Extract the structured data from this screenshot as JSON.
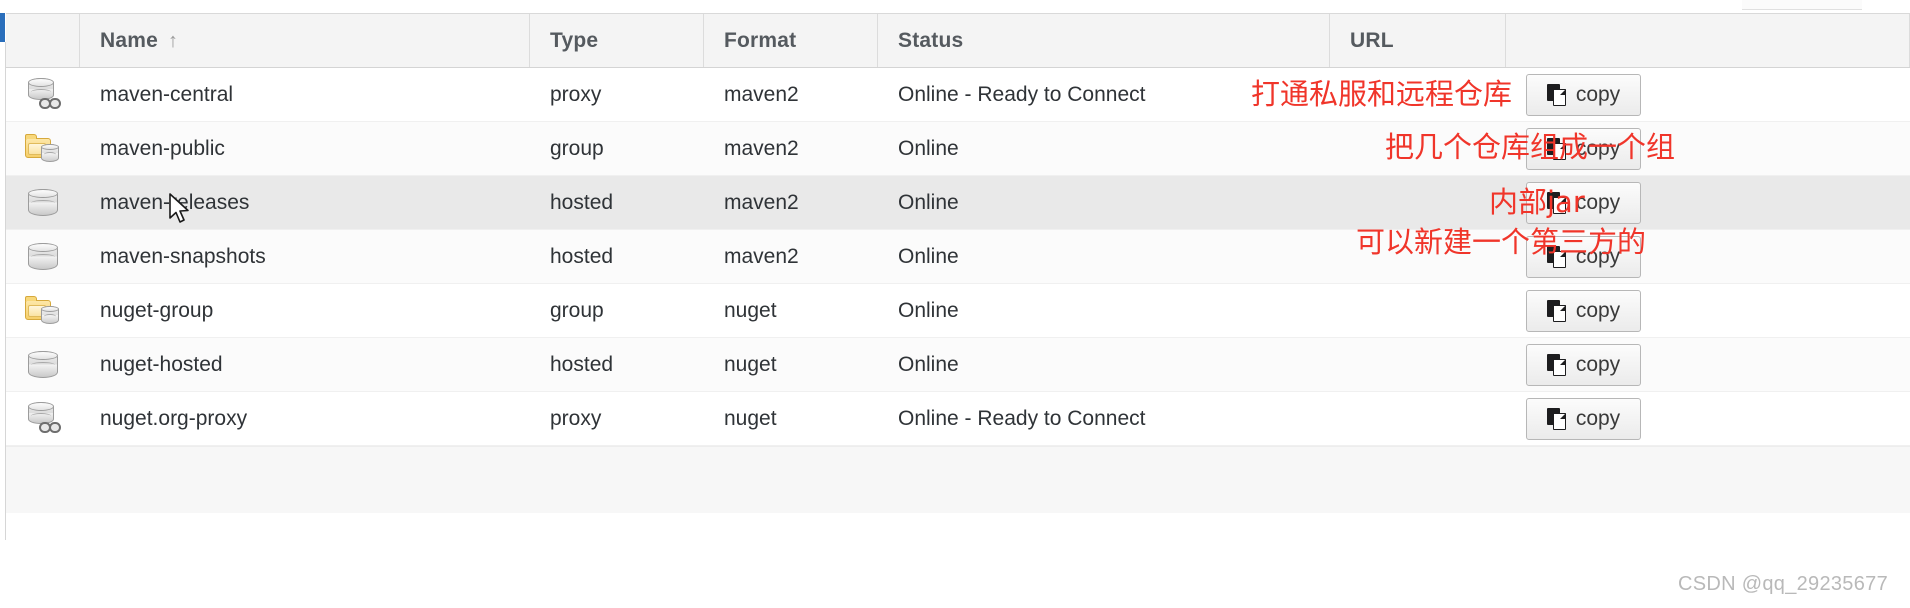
{
  "table": {
    "columns": [
      {
        "key": "icon",
        "label": ""
      },
      {
        "key": "name",
        "label": "Name",
        "sort": "↑"
      },
      {
        "key": "type",
        "label": "Type"
      },
      {
        "key": "format",
        "label": "Format"
      },
      {
        "key": "status",
        "label": "Status"
      },
      {
        "key": "url",
        "label": "URL"
      },
      {
        "key": "copy",
        "label": ""
      }
    ],
    "rows": [
      {
        "icon": "proxy-repository-icon",
        "name": "maven-central",
        "type": "proxy",
        "format": "maven2",
        "status": "Online - Ready to Connect",
        "copy_label": "copy"
      },
      {
        "icon": "group-repository-icon",
        "name": "maven-public",
        "type": "group",
        "format": "maven2",
        "status": "Online",
        "copy_label": "copy"
      },
      {
        "icon": "hosted-repository-icon",
        "name": "maven-releases",
        "type": "hosted",
        "format": "maven2",
        "status": "Online",
        "copy_label": "copy"
      },
      {
        "icon": "hosted-repository-icon",
        "name": "maven-snapshots",
        "type": "hosted",
        "format": "maven2",
        "status": "Online",
        "copy_label": "copy"
      },
      {
        "icon": "group-repository-icon",
        "name": "nuget-group",
        "type": "group",
        "format": "nuget",
        "status": "Online",
        "copy_label": "copy"
      },
      {
        "icon": "hosted-repository-icon",
        "name": "nuget-hosted",
        "type": "hosted",
        "format": "nuget",
        "status": "Online",
        "copy_label": "copy"
      },
      {
        "icon": "proxy-repository-icon",
        "name": "nuget.org-proxy",
        "type": "proxy",
        "format": "nuget",
        "status": "Online - Ready to Connect",
        "copy_label": "copy"
      }
    ]
  },
  "annotations": [
    {
      "id": "an1",
      "text": "打通私服和远程仓库"
    },
    {
      "id": "an2",
      "text": "把几个仓库组成一个组"
    },
    {
      "id": "an3",
      "text": "内部jar"
    },
    {
      "id": "an4",
      "text": "可以新建一个第三方的"
    }
  ],
  "watermark": "CSDN @qq_29235677",
  "colors": {
    "accent": "#2a6ebb",
    "annotation": "#f0352a",
    "header_bg": "#f4f4f4",
    "row_hover": "#e9e9e9"
  }
}
